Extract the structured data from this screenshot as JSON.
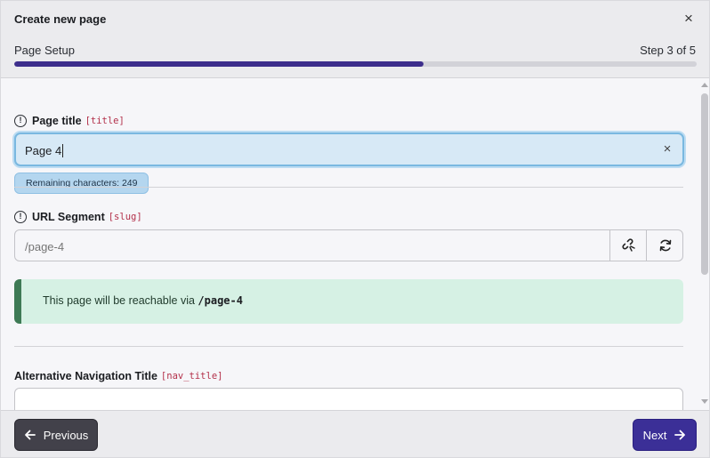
{
  "header": {
    "title": "Create new page",
    "close_label": "×",
    "step_label": "Page Setup",
    "step_count": "Step 3 of 5",
    "progress_fraction": 0.6
  },
  "fields": {
    "title": {
      "label": "Page title",
      "key": "[title]",
      "value": "Page 4",
      "tooltip": "Remaining characters: 249"
    },
    "slug": {
      "label": "URL Segment",
      "key": "[slug]",
      "placeholder": "/page-4",
      "link_icon": "unlink-icon",
      "refresh_icon": "refresh-icon"
    },
    "notice": {
      "text": "This page will be reachable via ",
      "path": "/page-4"
    },
    "nav_title": {
      "label": "Alternative Navigation Title",
      "key": "[nav_title]",
      "value": ""
    }
  },
  "footer": {
    "previous_label": "Previous",
    "next_label": "Next"
  },
  "colors": {
    "accent": "#3b2f97",
    "progress": "#3d2e8c",
    "success": "#3e7a55",
    "focus": "#7ab8e0"
  }
}
